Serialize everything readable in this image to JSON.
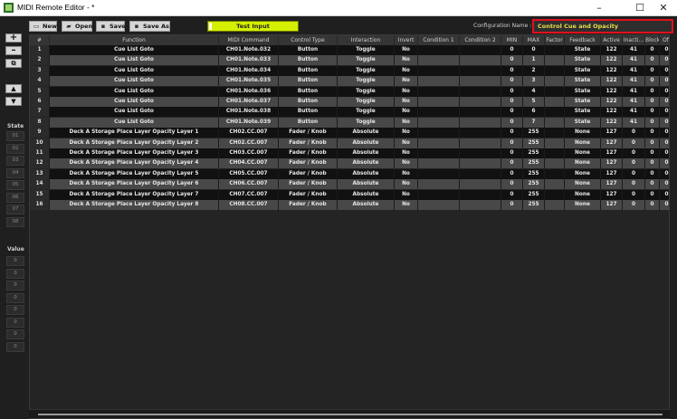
{
  "window": {
    "title": "MIDI Remote Editor - *",
    "minimize": "–",
    "maximize": "☐",
    "close": "✕"
  },
  "toolbar": {
    "new_label": "New",
    "open_label": "Open",
    "save_label": "Save",
    "save_as_label": "Save As",
    "test_input_label": "Test Input",
    "config_name_label": "Configuration Name :",
    "config_name_value": "Control Cue and Opacity"
  },
  "sidebar": {
    "add": "+",
    "remove": "–",
    "copy": "⧉",
    "up": "▲",
    "down": "▼",
    "state_label": "State",
    "state_slots": [
      "01",
      "02",
      "03",
      "04",
      "05",
      "06",
      "07",
      "08"
    ],
    "value_label": "Value",
    "value_slots": [
      "0",
      "0",
      "0",
      "0",
      "0",
      "0",
      "0",
      "0"
    ]
  },
  "table": {
    "columns": [
      "#",
      "Function",
      "MIDI Command",
      "Control Type",
      "Interaction",
      "Invert",
      "Condition 1",
      "Condition 2",
      "MIN",
      "MAX",
      "Factor",
      "Feedback",
      "Active",
      "Inacti...",
      "Block...",
      "Off"
    ],
    "rows": [
      [
        "1",
        "Cue List Goto",
        "CH01.Note.032",
        "Button",
        "Toggle",
        "No",
        "",
        "",
        "0",
        "0",
        "",
        "State",
        "122",
        "41",
        "0",
        "0"
      ],
      [
        "2",
        "Cue List Goto",
        "CH01.Note.033",
        "Button",
        "Toggle",
        "No",
        "",
        "",
        "0",
        "1",
        "",
        "State",
        "122",
        "41",
        "0",
        "0"
      ],
      [
        "3",
        "Cue List Goto",
        "CH01.Note.034",
        "Button",
        "Toggle",
        "No",
        "",
        "",
        "0",
        "2",
        "",
        "State",
        "122",
        "41",
        "0",
        "0"
      ],
      [
        "4",
        "Cue List Goto",
        "CH01.Note.035",
        "Button",
        "Toggle",
        "No",
        "",
        "",
        "0",
        "3",
        "",
        "State",
        "122",
        "41",
        "0",
        "0"
      ],
      [
        "5",
        "Cue List Goto",
        "CH01.Note.036",
        "Button",
        "Toggle",
        "No",
        "",
        "",
        "0",
        "4",
        "",
        "State",
        "122",
        "41",
        "0",
        "0"
      ],
      [
        "6",
        "Cue List Goto",
        "CH01.Note.037",
        "Button",
        "Toggle",
        "No",
        "",
        "",
        "0",
        "5",
        "",
        "State",
        "122",
        "41",
        "0",
        "0"
      ],
      [
        "7",
        "Cue List Goto",
        "CH01.Note.038",
        "Button",
        "Toggle",
        "No",
        "",
        "",
        "0",
        "6",
        "",
        "State",
        "122",
        "41",
        "0",
        "0"
      ],
      [
        "8",
        "Cue List Goto",
        "CH01.Note.039",
        "Button",
        "Toggle",
        "No",
        "",
        "",
        "0",
        "7",
        "",
        "State",
        "122",
        "41",
        "0",
        "0"
      ],
      [
        "9",
        "Deck A Storage Place Layer Opacity Layer 1",
        "CH02.CC.007",
        "Fader / Knob",
        "Absolute",
        "No",
        "",
        "",
        "0",
        "255",
        "",
        "None",
        "127",
        "0",
        "0",
        "0"
      ],
      [
        "10",
        "Deck A Storage Place Layer Opacity Layer 2",
        "CH02.CC.007",
        "Fader / Knob",
        "Absolute",
        "No",
        "",
        "",
        "0",
        "255",
        "",
        "None",
        "127",
        "0",
        "0",
        "0"
      ],
      [
        "11",
        "Deck A Storage Place Layer Opacity Layer 3",
        "CH03.CC.007",
        "Fader / Knob",
        "Absolute",
        "No",
        "",
        "",
        "0",
        "255",
        "",
        "None",
        "127",
        "0",
        "0",
        "0"
      ],
      [
        "12",
        "Deck A Storage Place Layer Opacity Layer 4",
        "CH04.CC.007",
        "Fader / Knob",
        "Absolute",
        "No",
        "",
        "",
        "0",
        "255",
        "",
        "None",
        "127",
        "0",
        "0",
        "0"
      ],
      [
        "13",
        "Deck A Storage Place Layer Opacity Layer 5",
        "CH05.CC.007",
        "Fader / Knob",
        "Absolute",
        "No",
        "",
        "",
        "0",
        "255",
        "",
        "None",
        "127",
        "0",
        "0",
        "0"
      ],
      [
        "14",
        "Deck A Storage Place Layer Opacity Layer 6",
        "CH06.CC.007",
        "Fader / Knob",
        "Absolute",
        "No",
        "",
        "",
        "0",
        "255",
        "",
        "None",
        "127",
        "0",
        "0",
        "0"
      ],
      [
        "15",
        "Deck A Storage Place Layer Opacity Layer 7",
        "CH07.CC.007",
        "Fader / Knob",
        "Absolute",
        "No",
        "",
        "",
        "0",
        "255",
        "",
        "None",
        "127",
        "0",
        "0",
        "0"
      ],
      [
        "16",
        "Deck A Storage Place Layer Opacity Layer 8",
        "CH08.CC.007",
        "Fader / Knob",
        "Absolute",
        "No",
        "",
        "",
        "0",
        "255",
        "",
        "None",
        "127",
        "0",
        "0",
        "0"
      ]
    ]
  },
  "colors": {
    "accent": "#d4f000",
    "highlight_border": "#e0101c",
    "config_text": "#e8dd4a"
  }
}
